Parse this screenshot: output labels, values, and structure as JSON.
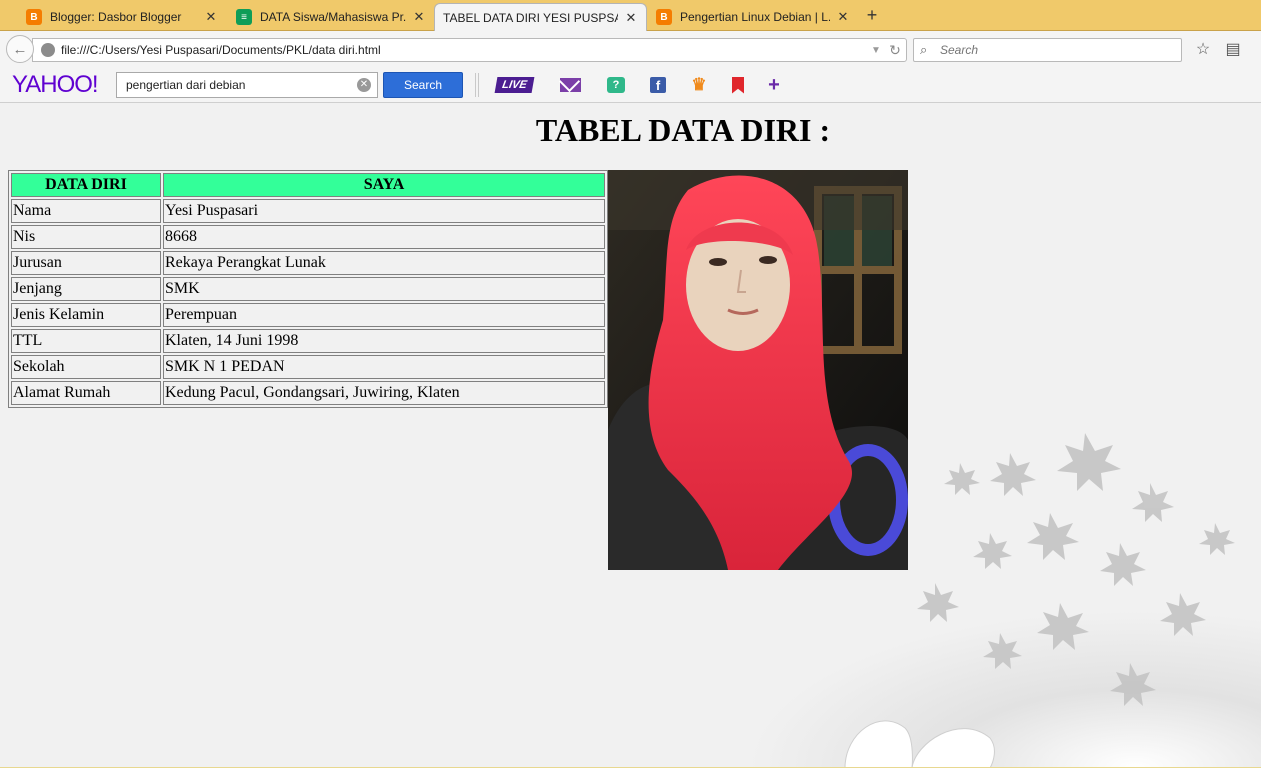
{
  "browser": {
    "tabs": [
      {
        "title": "Blogger: Dasbor Blogger",
        "icon": "blogger-icon",
        "active": false
      },
      {
        "title": "DATA Siswa/Mahasiswa Pr...",
        "icon": "sheets-icon",
        "active": false
      },
      {
        "title": "TABEL DATA DIRI YESI PUSPSARI",
        "icon": "",
        "active": true
      },
      {
        "title": "Pengertian Linux Debian | L...",
        "icon": "blogger-icon",
        "active": false
      }
    ],
    "new_tab": "+",
    "address": "file:///C:/Users/Yesi Puspasari/Documents/PKL/data diri.html",
    "search_placeholder": "Search"
  },
  "yahoo_toolbar": {
    "logo": "YAHOO!",
    "search_value": "pengertian dari debian",
    "search_button": "Search",
    "live_label": "LIVE",
    "answers_label": "?",
    "facebook_label": "f",
    "colors": {
      "brand": "#5f01d1",
      "button": "#2d6ed8"
    }
  },
  "page": {
    "title": "TABEL DATA DIRI :",
    "table": {
      "headers": [
        "DATA DIRI",
        "SAYA"
      ],
      "rows": [
        [
          "Nama",
          "Yesi Puspasari"
        ],
        [
          "Nis",
          "8668"
        ],
        [
          "Jurusan",
          "Rekaya Perangkat Lunak"
        ],
        [
          "Jenjang",
          "SMK"
        ],
        [
          "Jenis Kelamin",
          "Perempuan"
        ],
        [
          "TTL",
          "Klaten, 14 Juni 1998"
        ],
        [
          "Sekolah",
          "SMK N 1 PEDAN"
        ],
        [
          "Alamat Rumah",
          "Kedung Pacul, Gondangsari, Juwiring, Klaten"
        ]
      ],
      "header_color": "#33ff99"
    },
    "photo": "profile-photo"
  }
}
